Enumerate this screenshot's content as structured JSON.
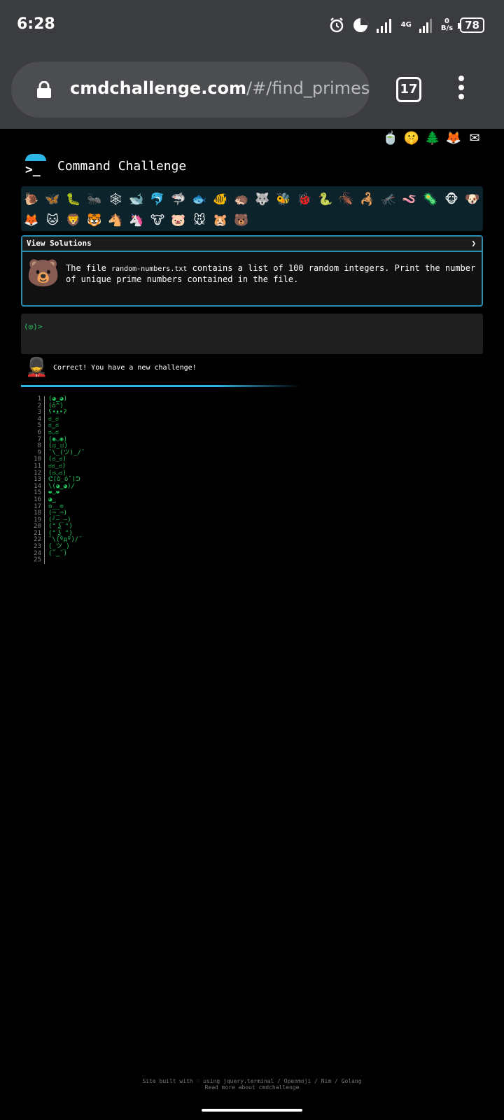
{
  "status": {
    "time": "6:28",
    "net_type": "4G",
    "net_speed": "0",
    "net_unit": "B/s",
    "battery": "78"
  },
  "browser": {
    "url_host": "cmdchallenge.com",
    "url_path": "/#/find_primes",
    "tab_count": "17"
  },
  "site": {
    "title": "Command Challenge",
    "top_icons": [
      "🍵",
      "🤫",
      "🌲",
      "🦊",
      "✉"
    ],
    "animals_row1": [
      "🐌",
      "🦋",
      "🐛",
      "🐜",
      "🕸",
      "🐋",
      "🐬",
      "🦈",
      "🐟",
      "🐠",
      "🦔",
      "🐺",
      "🐝",
      "🐞",
      "🐍",
      "🪳",
      "🦂",
      "🦟",
      "🪱",
      "🦠",
      "🐵",
      "🐶"
    ],
    "animals_row2": [
      "🦊",
      "🐱",
      "🦁",
      "🐯",
      "🐴",
      "🦄",
      "🐮",
      "🐷",
      "🐭",
      "🐹",
      "🐻"
    ]
  },
  "panel": {
    "header": "View Solutions",
    "caret": "❯",
    "icon": "🐻",
    "text_before": "The file ",
    "file": "random-numbers.txt",
    "text_after": " contains a list of 100 random integers. Print the number of unique prime numbers contained in the file."
  },
  "terminal": {
    "prompt": "(◎)>"
  },
  "result": {
    "icon": "💂",
    "message": "Correct! You have a new challenge!"
  },
  "lines": [
    {
      "n": "1",
      "t": "(◕‿◕)"
    },
    {
      "n": "2",
      "t": "(ô^)"
    },
    {
      "n": "3",
      "t": "ʕ•ᴥ•ʔ"
    },
    {
      "n": "4",
      "t": "ಠ_ಠ"
    },
    {
      "n": "5",
      "t": "ಠ‿ಠ"
    },
    {
      "n": "6",
      "t": "ಠ◡ಠ"
    },
    {
      "n": "7",
      "t": "(◉◡◉)"
    },
    {
      "n": "8",
      "t": "(ಥ_ಥ)"
    },
    {
      "n": "9",
      "t": "¯\\_(ツ)_/¯"
    },
    {
      "n": "10",
      "t": "(ಠ_ಠ)"
    },
    {
      "n": "11",
      "t": "ಠಠ_ಠ)"
    },
    {
      "n": "12",
      "t": "(ಠ◡ಠ)"
    },
    {
      "n": "13",
      "t": "ᕦ(ò_óˇ)ᕤ"
    },
    {
      "n": "14",
      "t": "\\(◕‿◕)/"
    },
    {
      "n": "15",
      "t": "❤◡❤"
    },
    {
      "n": "16",
      "t": "◕‿"
    },
    {
      "n": "17",
      "t": "⊙__⊙"
    },
    {
      "n": "18",
      "t": "(¬_¬)"
    },
    {
      "n": "19",
      "t": "(╯—_—)"
    },
    {
      "n": "20",
      "t": "(° ͜ʖ °)"
    },
    {
      "n": "21",
      "t": "(° ͜ʖ °)"
    },
    {
      "n": "22",
      "t": "¯\\(ºдº)/¯"
    },
    {
      "n": "23",
      "t": "(_ツ_)"
    },
    {
      "n": "24",
      "t": "(¯‿¯)"
    },
    {
      "n": "25",
      "t": ""
    }
  ],
  "footer": {
    "line1": "Site built with ♡ using jquery.terminal / Openmoji / Nim / Golang",
    "line2": "Read more about cmdchallenge"
  }
}
